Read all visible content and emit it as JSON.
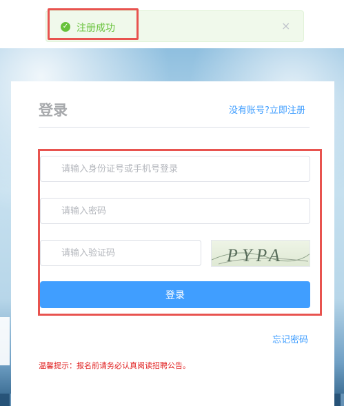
{
  "toast": {
    "message": "注册成功",
    "close_symbol": "×",
    "icon": "check-circle-icon",
    "color": "#67c23a"
  },
  "login": {
    "title": "登录",
    "register_link": "没有账号?立即注册",
    "id_placeholder": "请输入身份证号或手机号登录",
    "password_placeholder": "请输入密码",
    "captcha_placeholder": "请输入验证码",
    "captcha_text": "PYPA",
    "button_label": "登录",
    "forgot_link": "忘记密码",
    "tip": "温馨提示：报名前请务必认真阅读招聘公告。"
  },
  "colors": {
    "accent": "#409eff",
    "success": "#67c23a",
    "highlight": "#e8534f",
    "warning_text": "#e02020"
  }
}
